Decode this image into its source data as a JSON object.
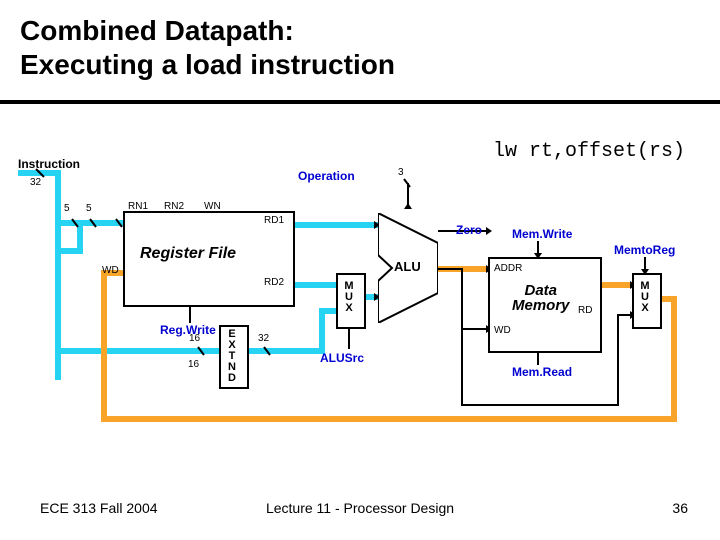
{
  "title_l1": "Combined Datapath:",
  "title_l2": "Executing a load instruction",
  "instruction_code": "lw rt,offset(rs)",
  "footer": {
    "left": "ECE 313 Fall 2004",
    "center": "Lecture 11 - Processor Design",
    "page": "36"
  },
  "labels": {
    "instruction": "Instruction",
    "operation": "Operation",
    "zero": "Zero",
    "rn1": "RN1",
    "rn2": "RN2",
    "wn": "WN",
    "rd1": "RD1",
    "rd2": "RD2",
    "wd": "WD",
    "regfile": "Register File",
    "regwrite": "Reg.Write",
    "alu": "ALU",
    "alusrc": "ALUSrc",
    "addr": "ADDR",
    "rd": "RD",
    "wd2": "WD",
    "datamem": "Data\nMemory",
    "memwrite": "Mem.Write",
    "memread": "Mem.Read",
    "memtoreg": "MemtoReg",
    "bits32": "32",
    "bits5": "5",
    "bits3": "3",
    "bits16": "16",
    "ext": "E\nX\nT\nN\nD",
    "mux": "M\nU\nX",
    "sixteen": "16"
  }
}
